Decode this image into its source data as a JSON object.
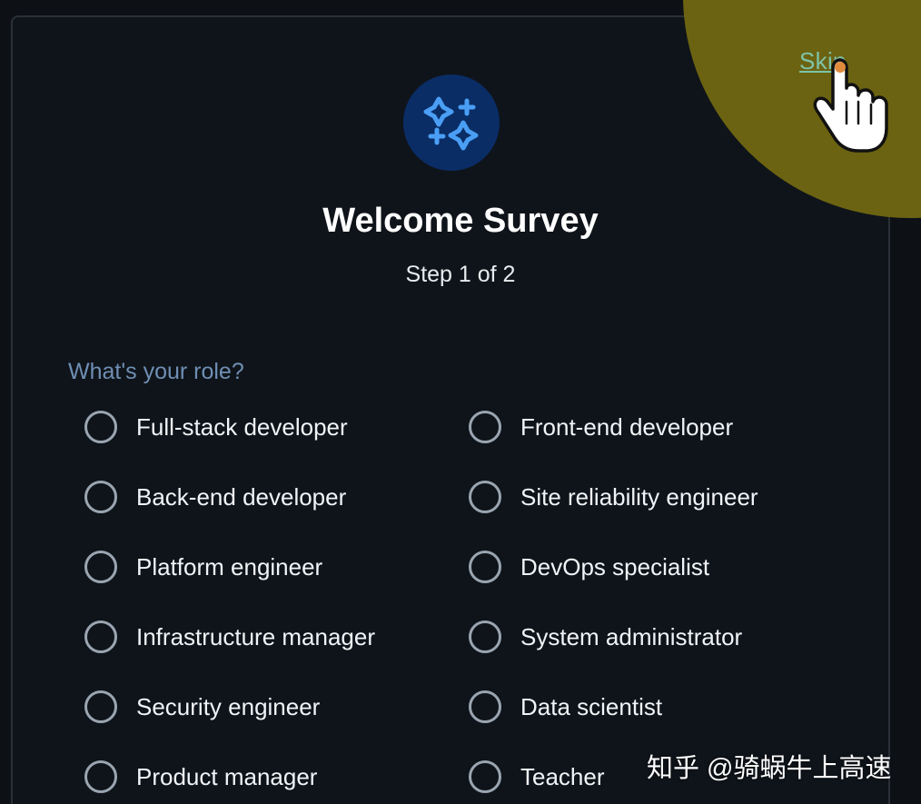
{
  "header": {
    "skip_label": "Skip"
  },
  "survey": {
    "title": "Welcome Survey",
    "step": "Step 1 of 2",
    "question": "What's your role?",
    "options_left": [
      "Full-stack developer",
      "Back-end developer",
      "Platform engineer",
      "Infrastructure manager",
      "Security engineer",
      "Product manager"
    ],
    "options_right": [
      "Front-end developer",
      "Site reliability engineer",
      "DevOps specialist",
      "System administrator",
      "Data scientist",
      "Teacher"
    ]
  },
  "watermark": {
    "text": "知乎 @骑蜗牛上高速"
  },
  "icons": {
    "logo": "sparkles-icon",
    "cursor": "hand-pointer-icon",
    "radio": "radio-unchecked-icon"
  },
  "colors": {
    "background": "#0d1116",
    "card_border": "#2a3038",
    "accent_blue": "#4a9ff5",
    "logo_bg": "#0a2d66",
    "question_text": "#6f8fb4",
    "skip_link": "#7ec3a8",
    "highlight": "#6b6311"
  }
}
